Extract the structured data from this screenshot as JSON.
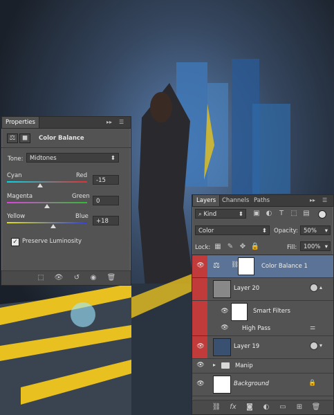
{
  "properties": {
    "tab_label": "Properties",
    "adjustment_title": "Color Balance",
    "tone_label": "Tone:",
    "tone_value": "Midtones",
    "sliders": [
      {
        "left": "Cyan",
        "right": "Red",
        "value": "-15",
        "position": 0.43,
        "left_color": "#00d8e8",
        "right_color": "#e23030"
      },
      {
        "left": "Magenta",
        "right": "Green",
        "value": "0",
        "position": 0.5,
        "left_color": "#e040e0",
        "right_color": "#30c030"
      },
      {
        "left": "Yellow",
        "right": "Blue",
        "value": "+18",
        "position": 0.58,
        "left_color": "#e0e020",
        "right_color": "#3040e0"
      }
    ],
    "preserve_label": "Preserve Luminosity",
    "preserve_checked": true
  },
  "layers": {
    "tabs": [
      "Layers",
      "Channels",
      "Paths"
    ],
    "filter_kind": "Kind",
    "blend_mode": "Color",
    "opacity_label": "Opacity:",
    "opacity_value": "50%",
    "lock_label": "Lock:",
    "fill_label": "Fill:",
    "fill_value": "100%",
    "items": {
      "color_balance": "Color Balance 1",
      "layer20": "Layer 20",
      "smart_filters": "Smart Filters",
      "high_pass": "High Pass",
      "layer19": "Layer 19",
      "manip": "Manip",
      "background": "Background"
    }
  },
  "colors": {
    "panel_bg": "#535353",
    "selected_row": "#5a7396",
    "red_row": "#c13b3b"
  }
}
